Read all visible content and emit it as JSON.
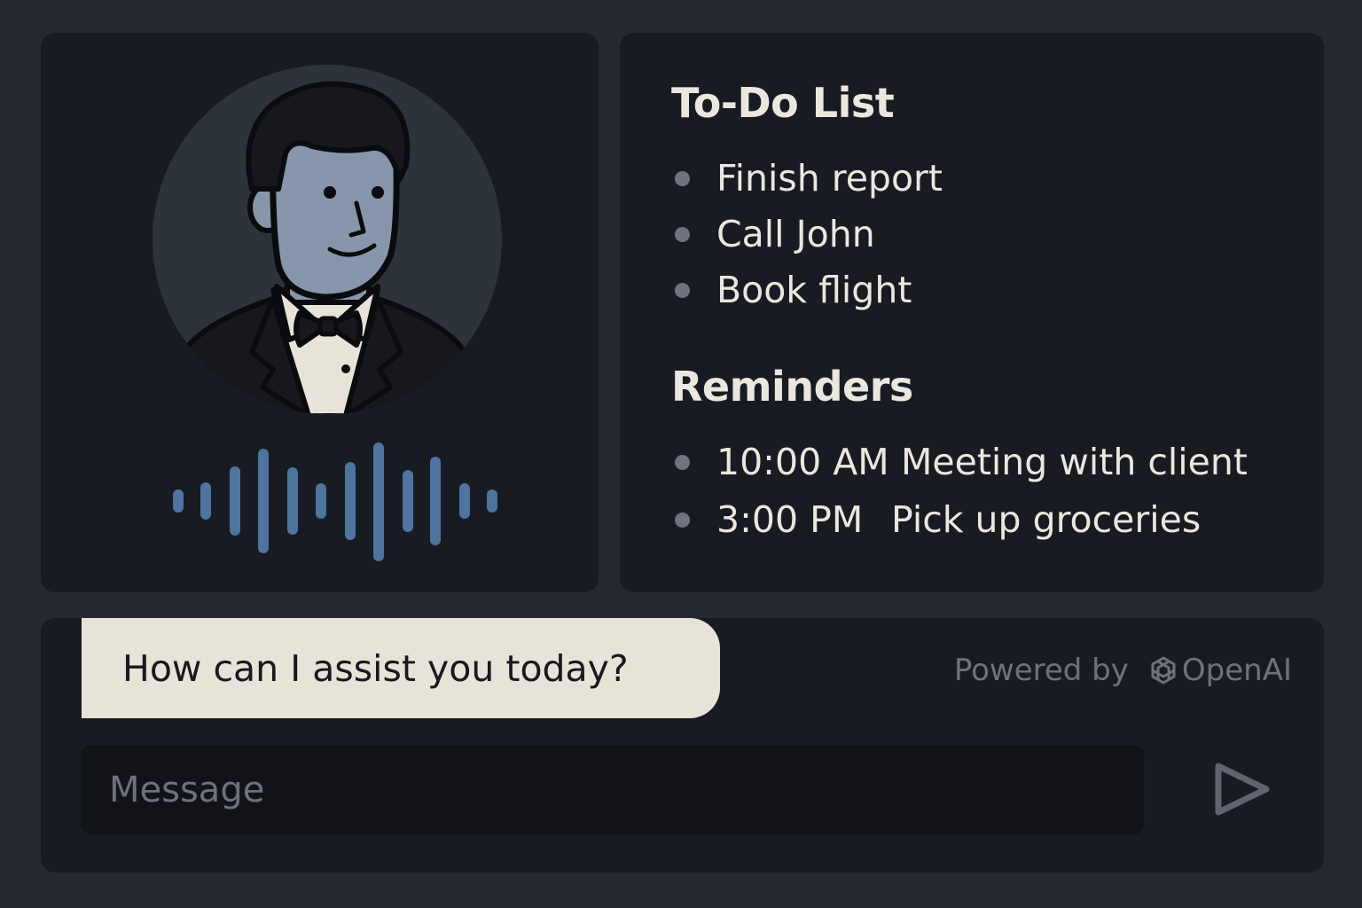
{
  "assistant": {
    "avatar_icon": "butler-avatar-icon",
    "waveform_icon": "voice-waveform-icon",
    "waveform_color": "#4e74a0"
  },
  "todo": {
    "title": "To-Do List",
    "items": [
      {
        "label": "Finish report"
      },
      {
        "label": "Call John"
      },
      {
        "label": "Book flight"
      }
    ]
  },
  "reminders": {
    "title": "Reminders",
    "items": [
      {
        "time": "10:00 AM",
        "label": "Meeting with client"
      },
      {
        "time": "3:00 PM",
        "label": "Pick up groceries"
      }
    ]
  },
  "chat": {
    "assistant_message": "How can I assist you today?",
    "powered_by": "Powered by",
    "brand": "OpenAI",
    "brand_icon": "openai-logo-icon",
    "input_placeholder": "Message",
    "input_value": "",
    "send_icon": "send-icon"
  },
  "colors": {
    "background": "#252932",
    "panel": "#181b22",
    "text_primary": "#ebe7df",
    "text_muted": "#6d727c",
    "bubble": "#e8e3d9",
    "input": "#111318"
  }
}
